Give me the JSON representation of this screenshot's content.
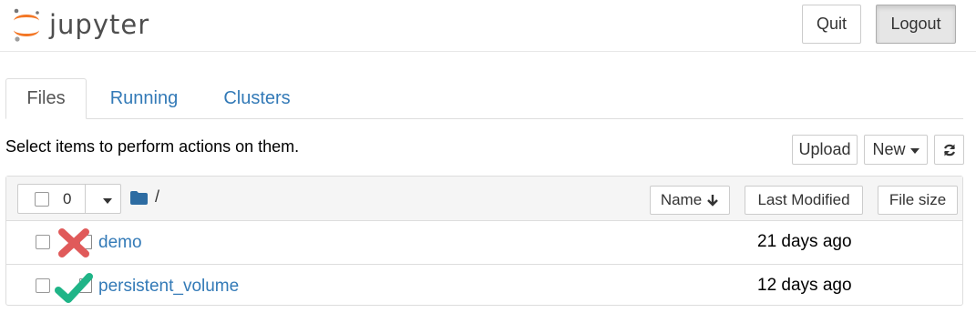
{
  "header": {
    "logo_text": "jupyter",
    "quit_label": "Quit",
    "logout_label": "Logout"
  },
  "tabs": [
    {
      "label": "Files",
      "active": true
    },
    {
      "label": "Running",
      "active": false
    },
    {
      "label": "Clusters",
      "active": false
    }
  ],
  "toolbar": {
    "instructions": "Select items to perform actions on them.",
    "upload_label": "Upload",
    "new_label": "New"
  },
  "list_header": {
    "selected_count": "0",
    "path": "/",
    "sort_name_label": "Name",
    "sort_modified_label": "Last Modified",
    "sort_size_label": "File size"
  },
  "items": [
    {
      "name": "demo",
      "modified": "21 days ago",
      "overlay": "red-x"
    },
    {
      "name": "persistent_volume",
      "modified": "12 days ago",
      "overlay": "green-check"
    }
  ],
  "colors": {
    "link": "#337ab7",
    "logo_orange": "#f37726",
    "red_x": "#e05a5a",
    "green_check": "#1fb487"
  }
}
